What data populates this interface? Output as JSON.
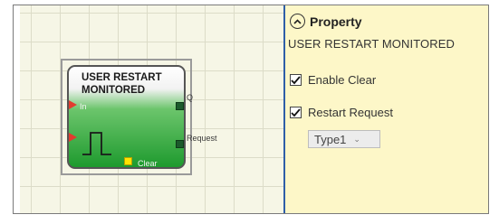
{
  "block": {
    "title_line1": "USER RESTART",
    "title_line2": "MONITORED",
    "pins": {
      "input": "In",
      "output_q": "Q",
      "request": "Request",
      "clear": "Clear"
    }
  },
  "properties": {
    "header": "Property",
    "block_name": "USER RESTART MONITORED",
    "options": [
      {
        "label": "Enable Clear",
        "checked": true
      },
      {
        "label": "Restart Request",
        "checked": true
      }
    ],
    "type_select": {
      "value": "Type1"
    }
  },
  "colors": {
    "canvas_bg": "#f6f6e6",
    "panel_bg": "#fdf7c8",
    "block_green": "#1e9a2e",
    "input_pin": "#e23b2f",
    "clear_pin": "#ffe400",
    "splitter": "#2f5fa8"
  }
}
